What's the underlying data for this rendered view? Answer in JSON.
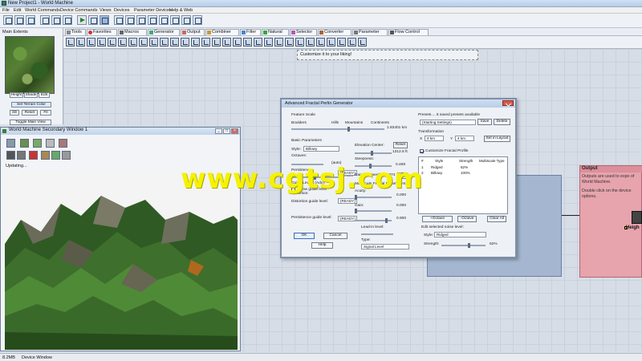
{
  "window": {
    "title": "New Project1 - World Machine"
  },
  "menu": [
    "File",
    "Edit",
    "World Commands",
    "Device Commands",
    "Views",
    "Devices",
    "Parameter Devices",
    "Help & Web"
  ],
  "tabs": [
    "Tools",
    "Favorites",
    "Macros",
    "Generator",
    "Output",
    "Combiner",
    "Filter",
    "Natural",
    "Selector",
    "Converter",
    "Parameter",
    "Flow Control"
  ],
  "active_tab": "Filter",
  "main_extents": {
    "title": "Main Extents",
    "buttons": [
      "Height",
      "Shade",
      "Edit",
      "Set Terrain Color",
      "3D",
      "Reset",
      "Fit",
      "Toggle Main View"
    ]
  },
  "note": {
    "text": "Customize it to your liking!"
  },
  "output_node": {
    "title": "Output",
    "desc": "Outputs are used to expo of World Machine.",
    "desc2": "Double click on the device options.",
    "port_label": "Heigh"
  },
  "secondary_window": {
    "title": "World Machine Secondary Window 1",
    "status": "Updating..."
  },
  "dialog": {
    "title": "Advanced Fractal Perlin Generator",
    "feature_scale": {
      "label": "Feature Scale",
      "ticks": [
        "Boulders",
        "Hills",
        "Mountains",
        "Continents"
      ],
      "value": "1.83401 km",
      "level": 0.62
    },
    "basic_params": "Basic Parameters",
    "style_label": "Style:",
    "style_value": "Billowy",
    "octaves_label": "Octaves:",
    "octaves_value": "(auto)",
    "persistence_label": "Persistence:",
    "persistence_value": "0.500",
    "guide_label": "Guide Levels (Adv):",
    "guide_value": "Show guide level",
    "distortion_label": "Distortion:",
    "distortion_guide": "Distortion guide level:",
    "persist_guide": "Persistence guide level:",
    "ready": "(READY)",
    "elev_label": "Elevation Center:",
    "elev_value": "1312.5 ft",
    "reset": "Reset",
    "steepness_label": "Steepness:",
    "steepness_value": "0.469",
    "seed_label": "Random Seed:",
    "seed_value": "61074",
    "new_seed": "New",
    "multiscale_label": "Multiscale Fractal Parameters",
    "acuity_label": "Acuity:",
    "acuity_value": "0.000",
    "gain_label": "Gain:",
    "gain_value": "0.000",
    "gain2_value": "0.900",
    "leadin_label": "Lead-in level:",
    "type_label": "Type:",
    "type_value": "Signal Level",
    "ok": "OK",
    "cancel": "Cancel",
    "help": "Help",
    "presets_label": "Presets.... 5 saved presets available",
    "presets_value": "(Starting Settings)",
    "save": "Save",
    "delete": "Delete",
    "transform_label": "Transformation",
    "x_label": "X",
    "x_value": "4 km",
    "y_label": "Y",
    "y_value": "4 km",
    "set_layout": "Set in Layout",
    "customize_label": "Customize Fractal Profile",
    "table_headers": [
      "#",
      "Style",
      "Strength",
      "Multiscale Type"
    ],
    "table_rows": [
      {
        "num": "1",
        "style": "Ridged",
        "strength": "62%"
      },
      {
        "num": "2",
        "style": "Billowy",
        "strength": "100%"
      }
    ],
    "add_octave": "+Octave",
    "remove_octave": "-Octave",
    "clear_all": "Clear All",
    "edit_level": "Edit selected noise level:",
    "style2_label": "Style:",
    "style2_value": "Ridged",
    "strength_label": "Strength:",
    "strength_value": "62%",
    "strength_level": 0.62
  },
  "watermark": "www.cgtsj.com",
  "status": {
    "left": "8.2MB",
    "mid": "Device Window"
  },
  "colors": {
    "watermark": "#f5f200",
    "output_node": "#e7a4ad",
    "blue_node": "#a5b6d0",
    "terrain_green": "#3f6f2a"
  }
}
